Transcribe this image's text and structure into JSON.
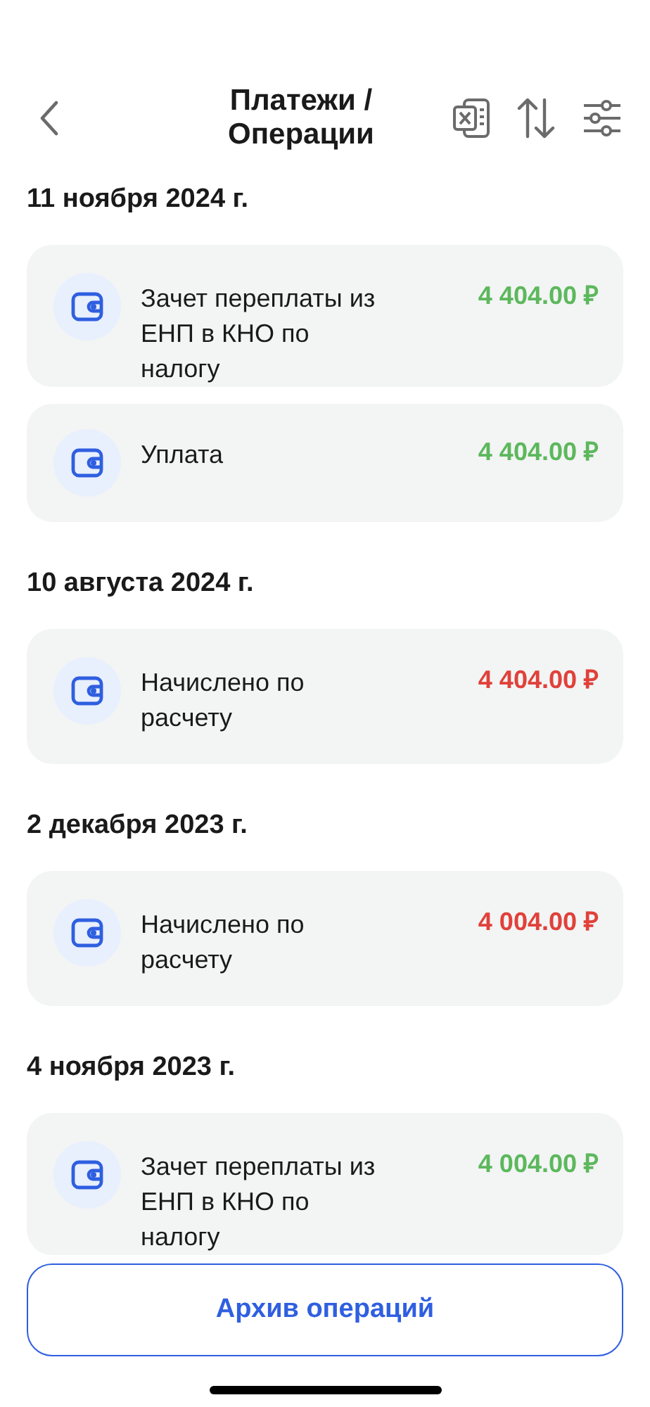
{
  "header": {
    "title": "Платежи / Операции"
  },
  "groups": [
    {
      "date": "11 ноября 2024 г.",
      "operations": [
        {
          "title": "Зачет переплаты из ЕНП в КНО по налогу",
          "amount": "4 404.00 ₽",
          "kind": "credit"
        },
        {
          "title": "Уплата",
          "amount": "4 404.00 ₽",
          "kind": "credit"
        }
      ]
    },
    {
      "date": "10 августа 2024 г.",
      "operations": [
        {
          "title": "Начислено по расчету",
          "amount": "4 404.00 ₽",
          "kind": "debit"
        }
      ]
    },
    {
      "date": "2 декабря 2023 г.",
      "operations": [
        {
          "title": "Начислено по расчету",
          "amount": "4 004.00 ₽",
          "kind": "debit"
        }
      ]
    },
    {
      "date": "4 ноября 2023 г.",
      "operations": [
        {
          "title": "Зачет переплаты из ЕНП в КНО по налогу",
          "amount": "4 004.00 ₽",
          "kind": "credit"
        }
      ]
    }
  ],
  "archive_button": "Архив операций"
}
